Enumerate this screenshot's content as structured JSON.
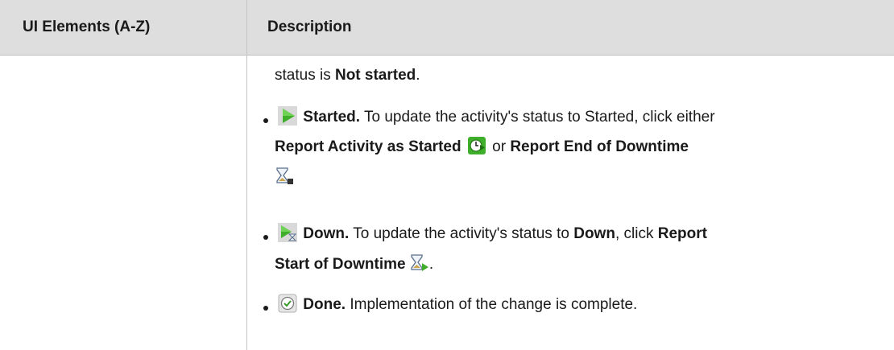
{
  "table": {
    "headers": {
      "col1": "UI Elements (A-Z)",
      "col2": "Description"
    }
  },
  "content": {
    "line0": {
      "pre": "status is ",
      "bold": "Not started",
      "post": "."
    },
    "started": {
      "title": "Started.",
      "text1": " To update the activity's status to Started, click either",
      "action1": "Report Activity as Started",
      "or": " or ",
      "action2": "Report End of Downtime"
    },
    "down": {
      "title": "Down.",
      "text1": " To update the activity's status to ",
      "bold1": "Down",
      "text2": ", click ",
      "action1_part1": "Report",
      "action1_part2": "Start of Downtime",
      "post": "."
    },
    "done": {
      "title": "Done.",
      "text": " Implementation of the change is complete."
    }
  },
  "icons": {
    "started": "play-triangle-icon",
    "report_started": "clock-play-icon",
    "end_downtime": "hourglass-stop-icon",
    "down": "play-hourglass-icon",
    "start_downtime": "hourglass-play-icon",
    "done": "checkmark-circle-icon"
  },
  "colors": {
    "header_bg": "#dedede",
    "icon_green": "#3fae2a",
    "text": "#1a1a1a"
  }
}
